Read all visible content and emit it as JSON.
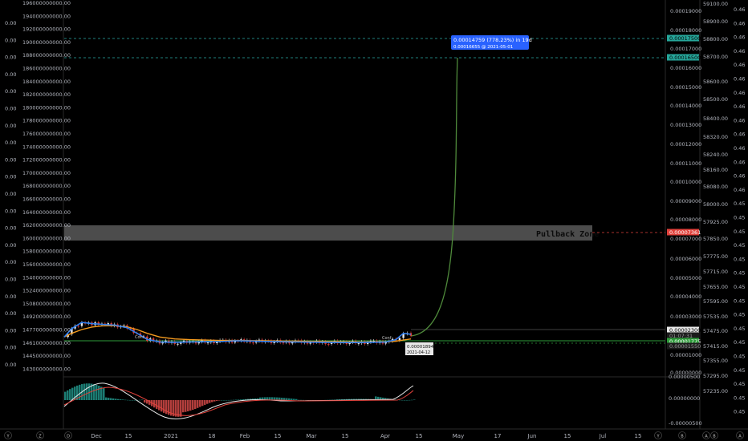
{
  "colors": {
    "background": "#000000",
    "up": "#e8e8e8",
    "down": "#e0413b",
    "ema_fast": "#2f7ff0",
    "ema_slow": "#f39a1e",
    "projection": "#4f8a3b",
    "support": "#2e9c3a",
    "resistance_dash": "#2aa9a5",
    "zone": "#8a8a8a",
    "zone_price": "#e0413b",
    "macd_pos": "#26a69a",
    "macd_neg": "#ef5350"
  },
  "left_scale": {
    "labels": [
      "196000000000.00",
      "194000000000.00",
      "192000000000.00",
      "190000000000.00",
      "188000000000.00",
      "186000000000.00",
      "184000000000.00",
      "182000000000.00",
      "180000000000.00",
      "178000000000.00",
      "176000000000.00",
      "174000000000.00",
      "172000000000.00",
      "170000000000.00",
      "168000000000.00",
      "166000000000.00",
      "164000000000.00",
      "162000000000.00",
      "160000000000.00",
      "158000000000.00",
      "156000000000.00",
      "154000000000.00",
      "152400000000.00",
      "150800000000.00",
      "149200000000.00",
      "147700000000.00",
      "146100000000.00",
      "144500000000.00",
      "143000000000.00"
    ],
    "aux_labels": [
      "0.00",
      "0.00",
      "0.00",
      "0.00",
      "0.00",
      "0.00",
      "0.00",
      "0.00",
      "0.00",
      "0.00",
      "0.00",
      "0.00",
      "0.00",
      "0.00",
      "0.00",
      "0.00",
      "0.00",
      "0.00",
      "0.00",
      "0.00",
      "0.00"
    ],
    "corner": "0.00"
  },
  "right_scale": {
    "labels": [
      "0.00019000",
      "0.00018000",
      "0.00017000",
      "0.00016000",
      "0.00015000",
      "0.00014000",
      "0.00013000",
      "0.00012000",
      "0.00011000",
      "0.00010000",
      "0.00009000",
      "0.00008000",
      "0.00007000",
      "0.00006000",
      "0.00005000",
      "0.00004000",
      "0.00003000",
      "0.00001000",
      "0.00000000"
    ],
    "tags": [
      {
        "text": "0.00017500",
        "style": "teal"
      },
      {
        "text": "0.00016500",
        "style": "teal"
      },
      {
        "text": "0.00007361",
        "style": "red"
      },
      {
        "text": "0.00002300",
        "style": "white"
      },
      {
        "text": "01:07:31",
        "style": "sub"
      },
      {
        "text": "0.00001775",
        "style": "green"
      },
      {
        "text": "0.00001550",
        "style": "sub"
      }
    ],
    "macd_labels": [
      "0.00000500",
      "0.00000000",
      "-0.00000500"
    ]
  },
  "far_right_scale": {
    "labels": [
      "59100.00",
      "58900.00",
      "58800.00",
      "58700.00",
      "58600.00",
      "58500.00",
      "58400.00",
      "58320.00",
      "58240.00",
      "58160.00",
      "58080.00",
      "58000.00",
      "57925.00",
      "57850.00",
      "57775.00",
      "57715.00",
      "57655.00",
      "57595.00",
      "57535.00",
      "57475.00",
      "57415.00",
      "57355.00",
      "57295.00",
      "57235.00"
    ],
    "secondary": [
      "0.46",
      "0.46",
      "0.46",
      "0.46",
      "0.46",
      "0.46",
      "0.46",
      "0.46",
      "0.46",
      "0.46",
      "0.46",
      "0.46",
      "0.46",
      "0.46",
      "0.45",
      "0.45",
      "0.45",
      "0.45",
      "0.45",
      "0.45",
      "0.45",
      "0.45",
      "0.45",
      "0.45",
      "0.45",
      "0.45",
      "0.45",
      "0.45",
      "0.45",
      "0.45"
    ]
  },
  "time_axis": {
    "labels": [
      "Dec",
      "15",
      "2021",
      "18",
      "Feb",
      "15",
      "Mar",
      "15",
      "Apr",
      "15",
      "May",
      "17",
      "Jun",
      "15",
      "Jul",
      "15"
    ],
    "bottom_icons": [
      "Y",
      "Z",
      "D",
      "Y",
      "B",
      "A",
      "B",
      "A"
    ]
  },
  "annotations": {
    "projection_label_line1": "0.00014759 (778.23%) in 19d",
    "projection_label_line2": "0.00016655 @ 2021-05-01",
    "zone_label": "Pullback Zone",
    "price_label_line1": "0.00001894",
    "price_label_line2": "2021-04-12",
    "small_text_1": "Conf...",
    "small_text_2": "Conf"
  },
  "chart_data": [
    {
      "type": "line",
      "title": "",
      "xlabel": "",
      "ylabel": "",
      "x": [
        "2020-11-25",
        "2020-11-28",
        "2020-12-02",
        "2020-12-06",
        "2020-12-10",
        "2020-12-15",
        "2020-12-20",
        "2020-12-24",
        "2020-12-28",
        "2021-01-02",
        "2021-01-08",
        "2021-01-14",
        "2021-01-20",
        "2021-01-26",
        "2021-02-01",
        "2021-02-07",
        "2021-02-13",
        "2021-02-19",
        "2021-02-25",
        "2021-03-03",
        "2021-03-09",
        "2021-03-15",
        "2021-03-21",
        "2021-03-27",
        "2021-04-02",
        "2021-04-06",
        "2021-04-09",
        "2021-04-12"
      ],
      "series": [
        {
          "values": [
            1.96e-05,
            2.4e-05,
            2.72e-05,
            2.66e-05,
            2.62e-05,
            2.58e-05,
            2.45e-05,
            2.15e-05,
            1.84e-05,
            1.7e-05,
            1.68e-05,
            1.7e-05,
            1.71e-05,
            1.72e-05,
            1.76e-05,
            1.75e-05,
            1.73e-05,
            1.71e-05,
            1.7e-05,
            1.69e-05,
            1.68e-05,
            1.67e-05,
            1.67e-05,
            1.68e-05,
            1.7e-05,
            1.82e-05,
            2.15e-05,
            2.1e-05
          ]
        },
        {
          "values": [
            1.96e-05,
            2.15e-05,
            2.35e-05,
            2.48e-05,
            2.54e-05,
            2.55e-05,
            2.49e-05,
            2.35e-05,
            2.15e-05,
            1.96e-05,
            1.86e-05,
            1.82e-05,
            1.8e-05,
            1.78e-05,
            1.78e-05,
            1.77e-05,
            1.76e-05,
            1.75e-05,
            1.74e-05,
            1.73e-05,
            1.72e-05,
            1.71e-05,
            1.7e-05,
            1.7e-05,
            1.71e-05,
            1.74e-05,
            1.8e-05,
            1.86e-05
          ]
        }
      ]
    },
    {
      "type": "line",
      "title": "",
      "x": [
        "2021-04-12",
        "2021-04-16",
        "2021-04-20",
        "2021-04-24",
        "2021-04-28",
        "2021-05-01"
      ],
      "values": [
        1.894e-05,
        2.5e-05,
        4.5e-05,
        8.5e-05,
        0.000135,
        0.00016655
      ]
    },
    {
      "type": "bar",
      "title": "",
      "categories": [
        "Dec",
        "15",
        "2021",
        "18",
        "Feb",
        "15",
        "Mar",
        "15",
        "Apr"
      ],
      "values": [
        4e-06,
        1e-06,
        -4e-06,
        -3e-06,
        5e-07,
        7e-07,
        2e-07,
        3e-07,
        1.2e-06
      ],
      "ylim": [
        -5e-06,
        5e-06
      ]
    }
  ]
}
